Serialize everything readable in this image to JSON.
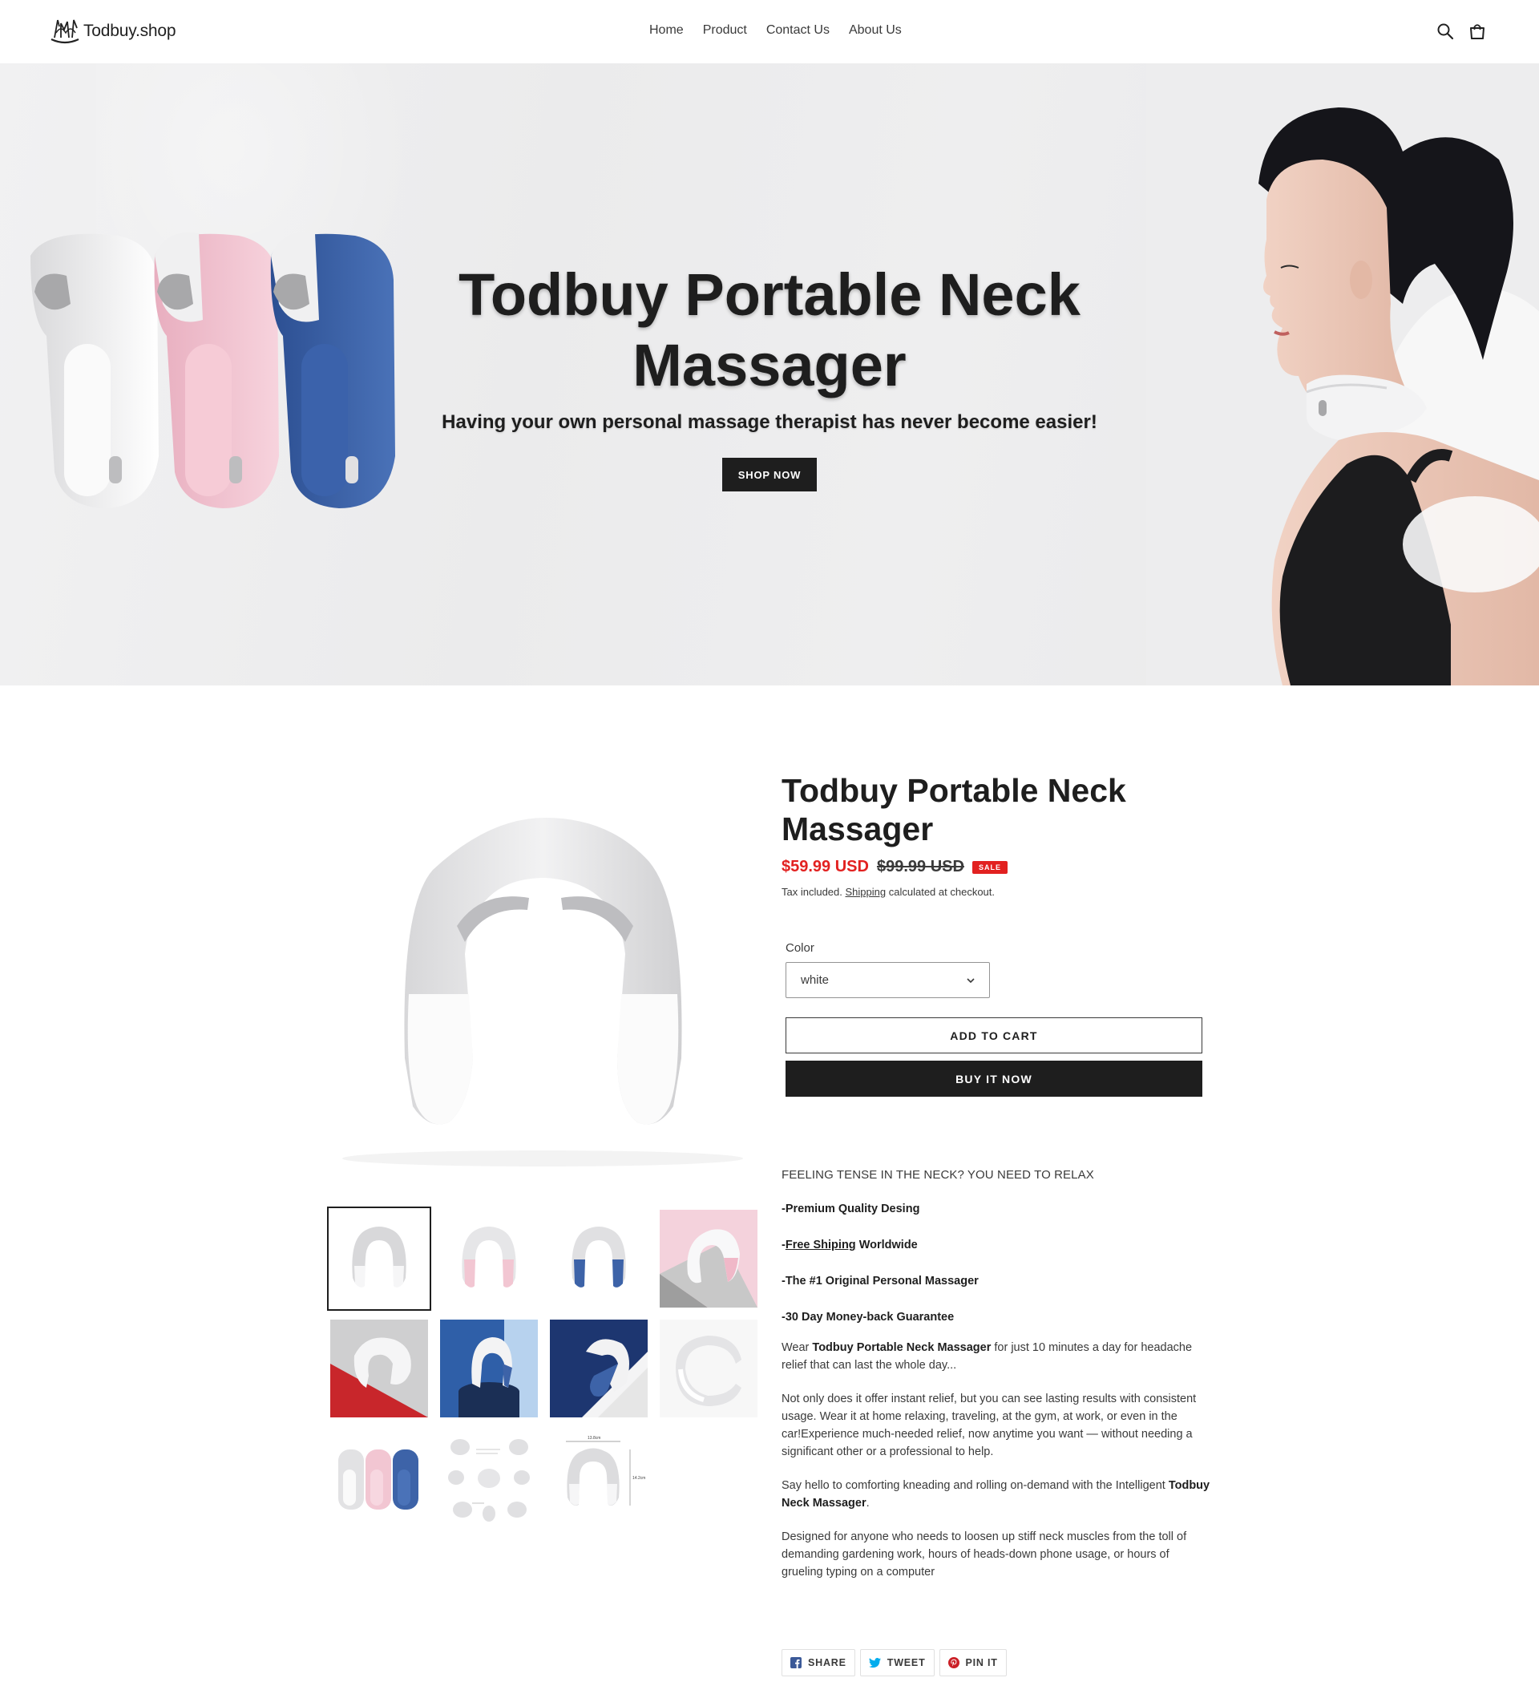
{
  "header": {
    "logo_text": "Todbuy.shop",
    "nav": [
      {
        "label": "Home",
        "active": true
      },
      {
        "label": "Product",
        "active": false
      },
      {
        "label": "Contact Us",
        "active": false
      },
      {
        "label": "About Us",
        "active": false
      }
    ],
    "icons": [
      "search-icon",
      "cart-icon"
    ]
  },
  "hero": {
    "title_line1": "Todbuy Portable Neck",
    "title_line2": "Massager",
    "subtitle": "Having your own personal massage therapist has never become easier!",
    "cta_label": "SHOP NOW"
  },
  "product": {
    "title": "Todbuy Portable Neck Massager",
    "price_sale": "$59.99 USD",
    "price_original": "$99.99 USD",
    "sale_badge": "SALE",
    "tax_prefix": "Tax included.",
    "tax_link": "Shipping",
    "tax_suffix": "calculated at checkout.",
    "color_label": "Color",
    "color_value": "white",
    "add_to_cart": "ADD TO CART",
    "buy_now": "BUY IT NOW",
    "thumbnail_count": 11,
    "selected_thumbnail": 1
  },
  "description": {
    "heading": "FEELING TENSE IN THE NECK? YOU NEED TO RELAX",
    "bullet1": "-Premium Quality Desing",
    "bullet2_prefix": "-",
    "bullet2_link": "Free Shiping",
    "bullet2_suffix": " Worldwide",
    "bullet3": "-The #1 Original Personal Massager",
    "bullet4": "-30 Day Money-back Guarantee",
    "p1_a": "Wear ",
    "p1_b": "Todbuy Portable Neck Massager",
    "p1_c": " for just 10 minutes a day for headache relief that can last the whole day...",
    "p2": "Not only does it offer instant relief, but you can see lasting results with consistent usage. Wear it at home relaxing, traveling, at the gym, at work, or even in the car!Experience much-needed relief, now anytime you want — without needing a significant other or a professional to help.",
    "p3_a": "Say hello to comforting kneading and rolling on-demand with the Intelligent ",
    "p3_b": "Todbuy Neck Massager",
    "p3_c": ".",
    "p4": "Designed for anyone who needs to loosen up stiff neck muscles from the toll of demanding gardening work, hours of heads-down phone usage, or hours of grueling typing on a computer"
  },
  "share": {
    "share": "SHARE",
    "tweet": "TWEET",
    "pin": "PIN IT"
  },
  "diagram_labels": {
    "width": "13.8cm",
    "height": "14.2cm"
  },
  "colors": {
    "sale_red": "#e22120",
    "dark": "#1e1e1e",
    "text": "#3a3a3a",
    "massager_pink": "#f2c6d2",
    "massager_blue": "#3d63a8"
  }
}
